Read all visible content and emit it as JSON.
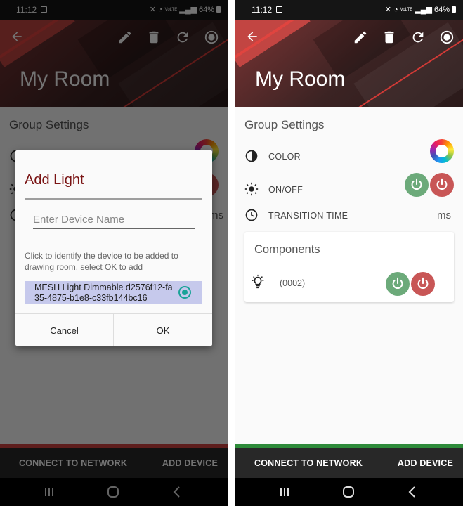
{
  "status_bar": {
    "time": "11:12",
    "network": "VoLTE",
    "battery": "64%"
  },
  "header": {
    "title": "My Room"
  },
  "group_settings": {
    "title": "Group Settings",
    "color_label": "COLOR",
    "onoff_label": "ON/OFF",
    "transition_label": "TRANSITION TIME",
    "transition_unit": "ms"
  },
  "components": {
    "title": "Components",
    "item_id": "(0002)"
  },
  "bottom_bar": {
    "connect_label": "CONNECT TO NETWORK",
    "add_label": "ADD DEVICE"
  },
  "dialog": {
    "title": "Add Light",
    "input_placeholder": "Enter Device Name",
    "help_text": "Click to identify the device to be added to drawing room, select OK to add",
    "device_item": "MESH Light Dimmable d2576f12-fa35-4875-b1e8-c33fb144bc16",
    "cancel_label": "Cancel",
    "ok_label": "OK"
  },
  "colors": {
    "accent_red": "#d04440",
    "accent_green": "#2e8b3a",
    "power_on": "#6caa7a",
    "power_off": "#c85656",
    "dialog_title": "#7a1414",
    "radio": "#1aa398"
  }
}
